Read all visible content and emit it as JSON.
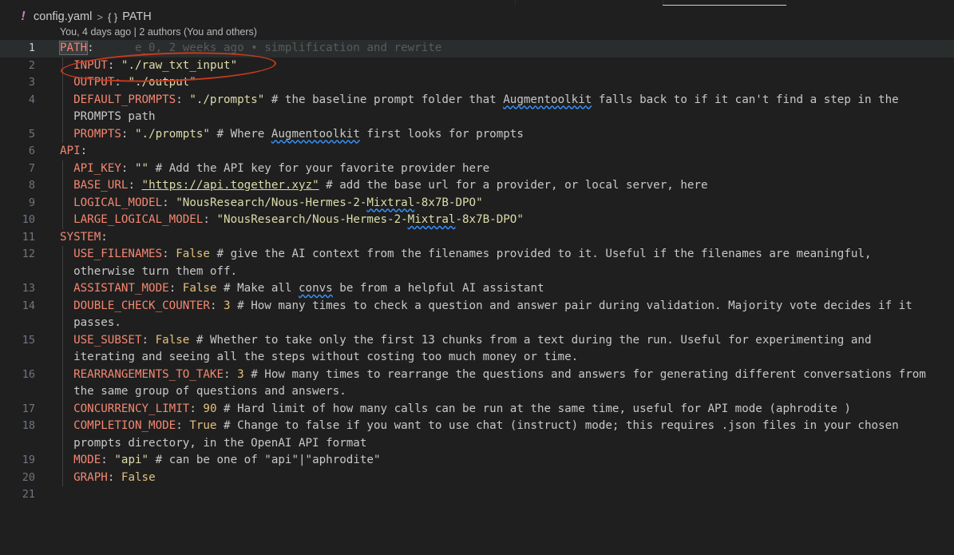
{
  "breadcrumb": {
    "file_name": "config.yaml",
    "separator": ">",
    "symbol_icon": "{ }",
    "symbol_name": "PATH"
  },
  "codelens": "You, 4 days ago | 2 authors (You and others)",
  "blame_inline": "e_0, 2 weeks ago • simplification and rewrite",
  "lines": [
    {
      "n": "1",
      "key": "PATH",
      "rest": ""
    },
    {
      "n": "2",
      "key": "INPUT",
      "value": "\"./raw_txt_input\""
    },
    {
      "n": "3",
      "key": "OUTPUT",
      "value": "\"./output\""
    },
    {
      "n": "4",
      "key": "DEFAULT_PROMPTS",
      "value": "\"./prompts\"",
      "comment_a": "# the baseline prompt folder that ",
      "comment_sq": "Augmentoolkit",
      "comment_b": " falls back to if it can't find a step in the",
      "comment_c": "PROMPTS path"
    },
    {
      "n": "5",
      "key": "PROMPTS",
      "value": "\"./prompts\"",
      "comment_a": "# Where ",
      "comment_sq": "Augmentoolkit",
      "comment_b": " first looks for prompts"
    },
    {
      "n": "6",
      "key": "API"
    },
    {
      "n": "7",
      "key": "API_KEY",
      "value": "\"\"",
      "comment": "# Add the API key for your favorite provider here"
    },
    {
      "n": "8",
      "key": "BASE_URL",
      "value": "\"https://api.together.xyz\"",
      "comment": "# add the base url for a provider, or local server, here"
    },
    {
      "n": "9",
      "key": "LOGICAL_MODEL",
      "value_a": "\"NousResearch/Nous-Hermes-2-",
      "value_sq": "Mixtral",
      "value_b": "-8x7B-DPO\""
    },
    {
      "n": "10",
      "key": "LARGE_LOGICAL_MODEL",
      "value_a": "\"NousResearch/Nous-Hermes-2-",
      "value_sq": "Mixtral",
      "value_b": "-8x7B-DPO\""
    },
    {
      "n": "11",
      "key": "SYSTEM"
    },
    {
      "n": "12",
      "key": "USE_FILENAMES",
      "value": "False",
      "comment": "# give the AI context from the filenames provided to it. Useful if the filenames are meaningful,",
      "comment_c": "otherwise turn them off."
    },
    {
      "n": "13",
      "key": "ASSISTANT_MODE",
      "value": "False",
      "comment_a": "# Make all ",
      "comment_sq": "convs",
      "comment_b": " be from a helpful AI assistant"
    },
    {
      "n": "14",
      "key": "DOUBLE_CHECK_COUNTER",
      "value": "3",
      "comment": "# How many times to check a question and answer pair during validation. Majority vote decides if it",
      "comment_c": "passes."
    },
    {
      "n": "15",
      "key": "USE_SUBSET",
      "value": "False",
      "comment": "# Whether to take only the first 13 chunks from a text during the run. Useful for experimenting and",
      "comment_c": "iterating and seeing all the steps without costing too much money or time."
    },
    {
      "n": "16",
      "key": "REARRANGEMENTS_TO_TAKE",
      "value": "3",
      "comment": "# How many times to rearrange the questions and answers for generating different conversations from",
      "comment_c": "the same group of questions and answers."
    },
    {
      "n": "17",
      "key": "CONCURRENCY_LIMIT",
      "value": "90",
      "comment": "# Hard limit of how many calls can be run at the same time, useful for API mode (aphrodite )"
    },
    {
      "n": "18",
      "key": "COMPLETION_MODE",
      "value": "True",
      "comment": "# Change to false if you want to use chat (instruct) mode; this requires .json files in your chosen",
      "comment_c": "prompts directory, in the OpenAI API format"
    },
    {
      "n": "19",
      "key": "MODE",
      "value": "\"api\"",
      "comment": "# can be one of \"api\"|\"aphrodite\""
    },
    {
      "n": "20",
      "key": "GRAPH",
      "value": "False"
    },
    {
      "n": "21"
    }
  ]
}
